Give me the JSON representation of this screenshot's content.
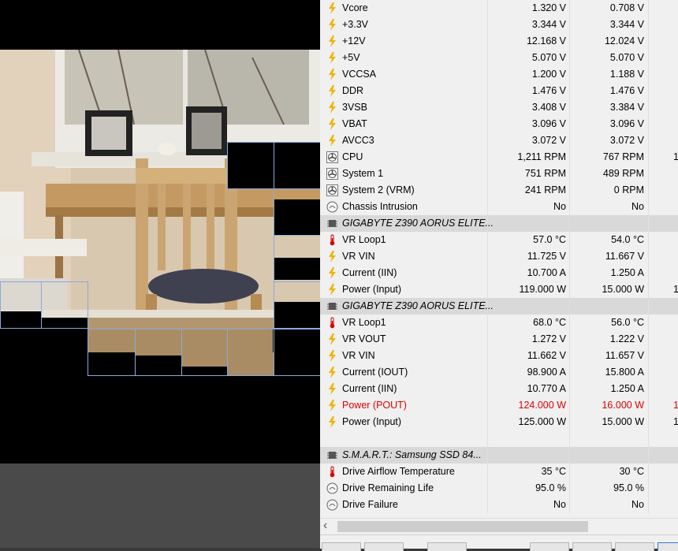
{
  "rows": [
    {
      "icon": "bolt",
      "name": "Vcore",
      "v1": "1.320 V",
      "v2": "0.708 V",
      "v3": ""
    },
    {
      "icon": "bolt",
      "name": "+3.3V",
      "v1": "3.344 V",
      "v2": "3.344 V",
      "v3": ""
    },
    {
      "icon": "bolt",
      "name": "+12V",
      "v1": "12.168 V",
      "v2": "12.024 V",
      "v3": ""
    },
    {
      "icon": "bolt",
      "name": "+5V",
      "v1": "5.070 V",
      "v2": "5.070 V",
      "v3": ""
    },
    {
      "icon": "bolt",
      "name": "VCCSA",
      "v1": "1.200 V",
      "v2": "1.188 V",
      "v3": ""
    },
    {
      "icon": "bolt",
      "name": "DDR",
      "v1": "1.476 V",
      "v2": "1.476 V",
      "v3": ""
    },
    {
      "icon": "bolt",
      "name": "3VSB",
      "v1": "3.408 V",
      "v2": "3.384 V",
      "v3": ""
    },
    {
      "icon": "bolt",
      "name": "VBAT",
      "v1": "3.096 V",
      "v2": "3.096 V",
      "v3": ""
    },
    {
      "icon": "bolt",
      "name": "AVCC3",
      "v1": "3.072 V",
      "v2": "3.072 V",
      "v3": ""
    },
    {
      "icon": "fan",
      "name": "CPU",
      "v1": "1,211 RPM",
      "v2": "767 RPM",
      "v3": "1"
    },
    {
      "icon": "fan",
      "name": "System 1",
      "v1": "751 RPM",
      "v2": "489 RPM",
      "v3": ""
    },
    {
      "icon": "fan",
      "name": "System 2 (VRM)",
      "v1": "241 RPM",
      "v2": "0 RPM",
      "v3": ""
    },
    {
      "icon": "gauge",
      "name": "Chassis Intrusion",
      "v1": "No",
      "v2": "No",
      "v3": ""
    },
    {
      "icon": "chip",
      "name": "GIGABYTE Z390 AORUS ELITE...",
      "v1": "",
      "v2": "",
      "v3": "",
      "header": true
    },
    {
      "icon": "therm",
      "name": "VR Loop1",
      "v1": "57.0 °C",
      "v2": "54.0 °C",
      "v3": ""
    },
    {
      "icon": "bolt",
      "name": "VR VIN",
      "v1": "11.725 V",
      "v2": "11.667 V",
      "v3": ""
    },
    {
      "icon": "bolt",
      "name": "Current (IIN)",
      "v1": "10.700 A",
      "v2": "1.250 A",
      "v3": ""
    },
    {
      "icon": "bolt",
      "name": "Power (Input)",
      "v1": "119.000 W",
      "v2": "15.000 W",
      "v3": "1"
    },
    {
      "icon": "chip",
      "name": "GIGABYTE Z390 AORUS ELITE...",
      "v1": "",
      "v2": "",
      "v3": "",
      "header": true
    },
    {
      "icon": "therm",
      "name": "VR Loop1",
      "v1": "68.0 °C",
      "v2": "56.0 °C",
      "v3": ""
    },
    {
      "icon": "bolt",
      "name": "VR VOUT",
      "v1": "1.272 V",
      "v2": "1.222 V",
      "v3": ""
    },
    {
      "icon": "bolt",
      "name": "VR VIN",
      "v1": "11.662 V",
      "v2": "11.657 V",
      "v3": ""
    },
    {
      "icon": "bolt",
      "name": "Current (IOUT)",
      "v1": "98.900 A",
      "v2": "15.800 A",
      "v3": ""
    },
    {
      "icon": "bolt",
      "name": "Current (IIN)",
      "v1": "10.770 A",
      "v2": "1.250 A",
      "v3": ""
    },
    {
      "icon": "bolt",
      "name": "Power (POUT)",
      "v1": "124.000 W",
      "v2": "16.000 W",
      "v3": "1",
      "red": true
    },
    {
      "icon": "bolt",
      "name": "Power (Input)",
      "v1": "125.000 W",
      "v2": "15.000 W",
      "v3": "1"
    },
    {
      "icon": "",
      "name": "",
      "v1": "",
      "v2": "",
      "v3": ""
    },
    {
      "icon": "chip",
      "name": "S.M.A.R.T.: Samsung SSD 84...",
      "v1": "",
      "v2": "",
      "v3": "",
      "header": true
    },
    {
      "icon": "therm",
      "name": "Drive Airflow Temperature",
      "v1": "35 °C",
      "v2": "30 °C",
      "v3": ""
    },
    {
      "icon": "gauge",
      "name": "Drive Remaining Life",
      "v1": "95.0 %",
      "v2": "95.0 %",
      "v3": ""
    },
    {
      "icon": "gauge",
      "name": "Drive Failure",
      "v1": "No",
      "v2": "No",
      "v3": ""
    }
  ],
  "colors": {
    "bolt": "#f0b400",
    "red": "#e00000",
    "header_bg": "#d9d9d9",
    "selection": "#8aa9d9"
  }
}
